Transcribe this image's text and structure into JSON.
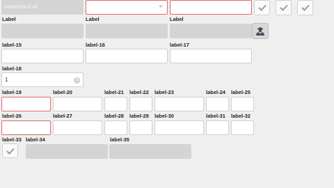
{
  "row1": {
    "date_value": "09/05/2024 07:48",
    "select_value": "",
    "text_value": ""
  },
  "row2": {
    "label_a": "Label",
    "label_b": "Label",
    "label_c": "Label"
  },
  "row3": {
    "label_15": "label-15",
    "label_16": "label-16",
    "label_17": "label-17"
  },
  "row4": {
    "label_18": "label-18",
    "number_value": "1"
  },
  "row5": {
    "labels": [
      "label-19",
      "label-20",
      "label-21",
      "label-22",
      "label-23",
      "label-24",
      "label-25"
    ]
  },
  "row6": {
    "labels": [
      "label-26",
      "label-27",
      "label-28",
      "label-29",
      "label-30",
      "label-31",
      "label-32"
    ]
  },
  "row7": {
    "labels": [
      "label-33",
      "label-34",
      "label-35"
    ]
  },
  "icons": {
    "check": "check-icon",
    "agent": "agent-icon",
    "clear": "clear-icon",
    "chevron": "chevron-down-icon"
  },
  "colors": {
    "invalid_border": "#e06666",
    "disabled_fill": "#d4d4d4",
    "check_color": "#9a9a9a"
  }
}
